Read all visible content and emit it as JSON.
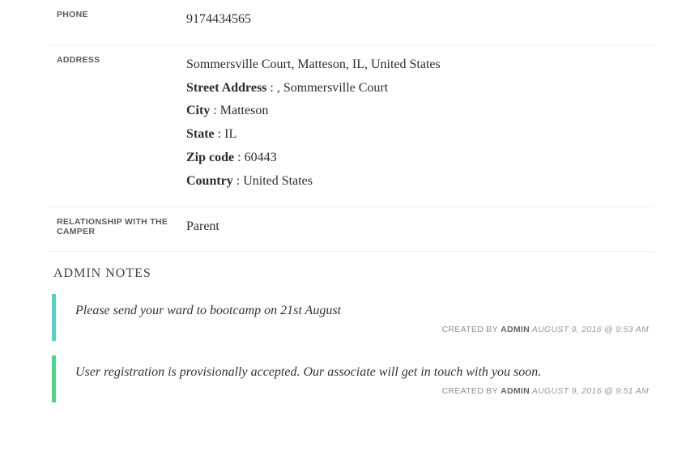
{
  "fields": {
    "phone": {
      "label": "PHONE",
      "value": "9174434565"
    },
    "address": {
      "label": "ADDRESS",
      "full": "Sommersville Court, Matteson, IL, United States",
      "lines": {
        "street": {
          "key": "Street Address",
          "sep": " : , ",
          "val": "Sommersville Court"
        },
        "city": {
          "key": "City",
          "sep": " : ",
          "val": "Matteson"
        },
        "state": {
          "key": "State",
          "sep": " : ",
          "val": "IL"
        },
        "zip": {
          "key": "Zip code",
          "sep": " : ",
          "val": "60443"
        },
        "country": {
          "key": "Country",
          "sep": " : ",
          "val": "United States"
        }
      }
    },
    "relationship": {
      "label": "RELATIONSHIP WITH THE CAMPER",
      "value": "Parent"
    }
  },
  "adminNotes": {
    "title": "ADMIN NOTES",
    "items": [
      {
        "accent": "#4CD6C3",
        "text": "Please send your ward to bootcamp on 21st August",
        "created_by_label": "CREATED BY",
        "created_by": "ADMIN",
        "timestamp": "AUGUST 9, 2016 @ 9:53 AM"
      },
      {
        "accent": "#4CD68A",
        "text": "User registration is provisionally accepted. Our associate will get in touch with you soon.",
        "created_by_label": "CREATED BY",
        "created_by": "ADMIN",
        "timestamp": "AUGUST 9, 2016 @ 9:51 AM"
      }
    ]
  }
}
